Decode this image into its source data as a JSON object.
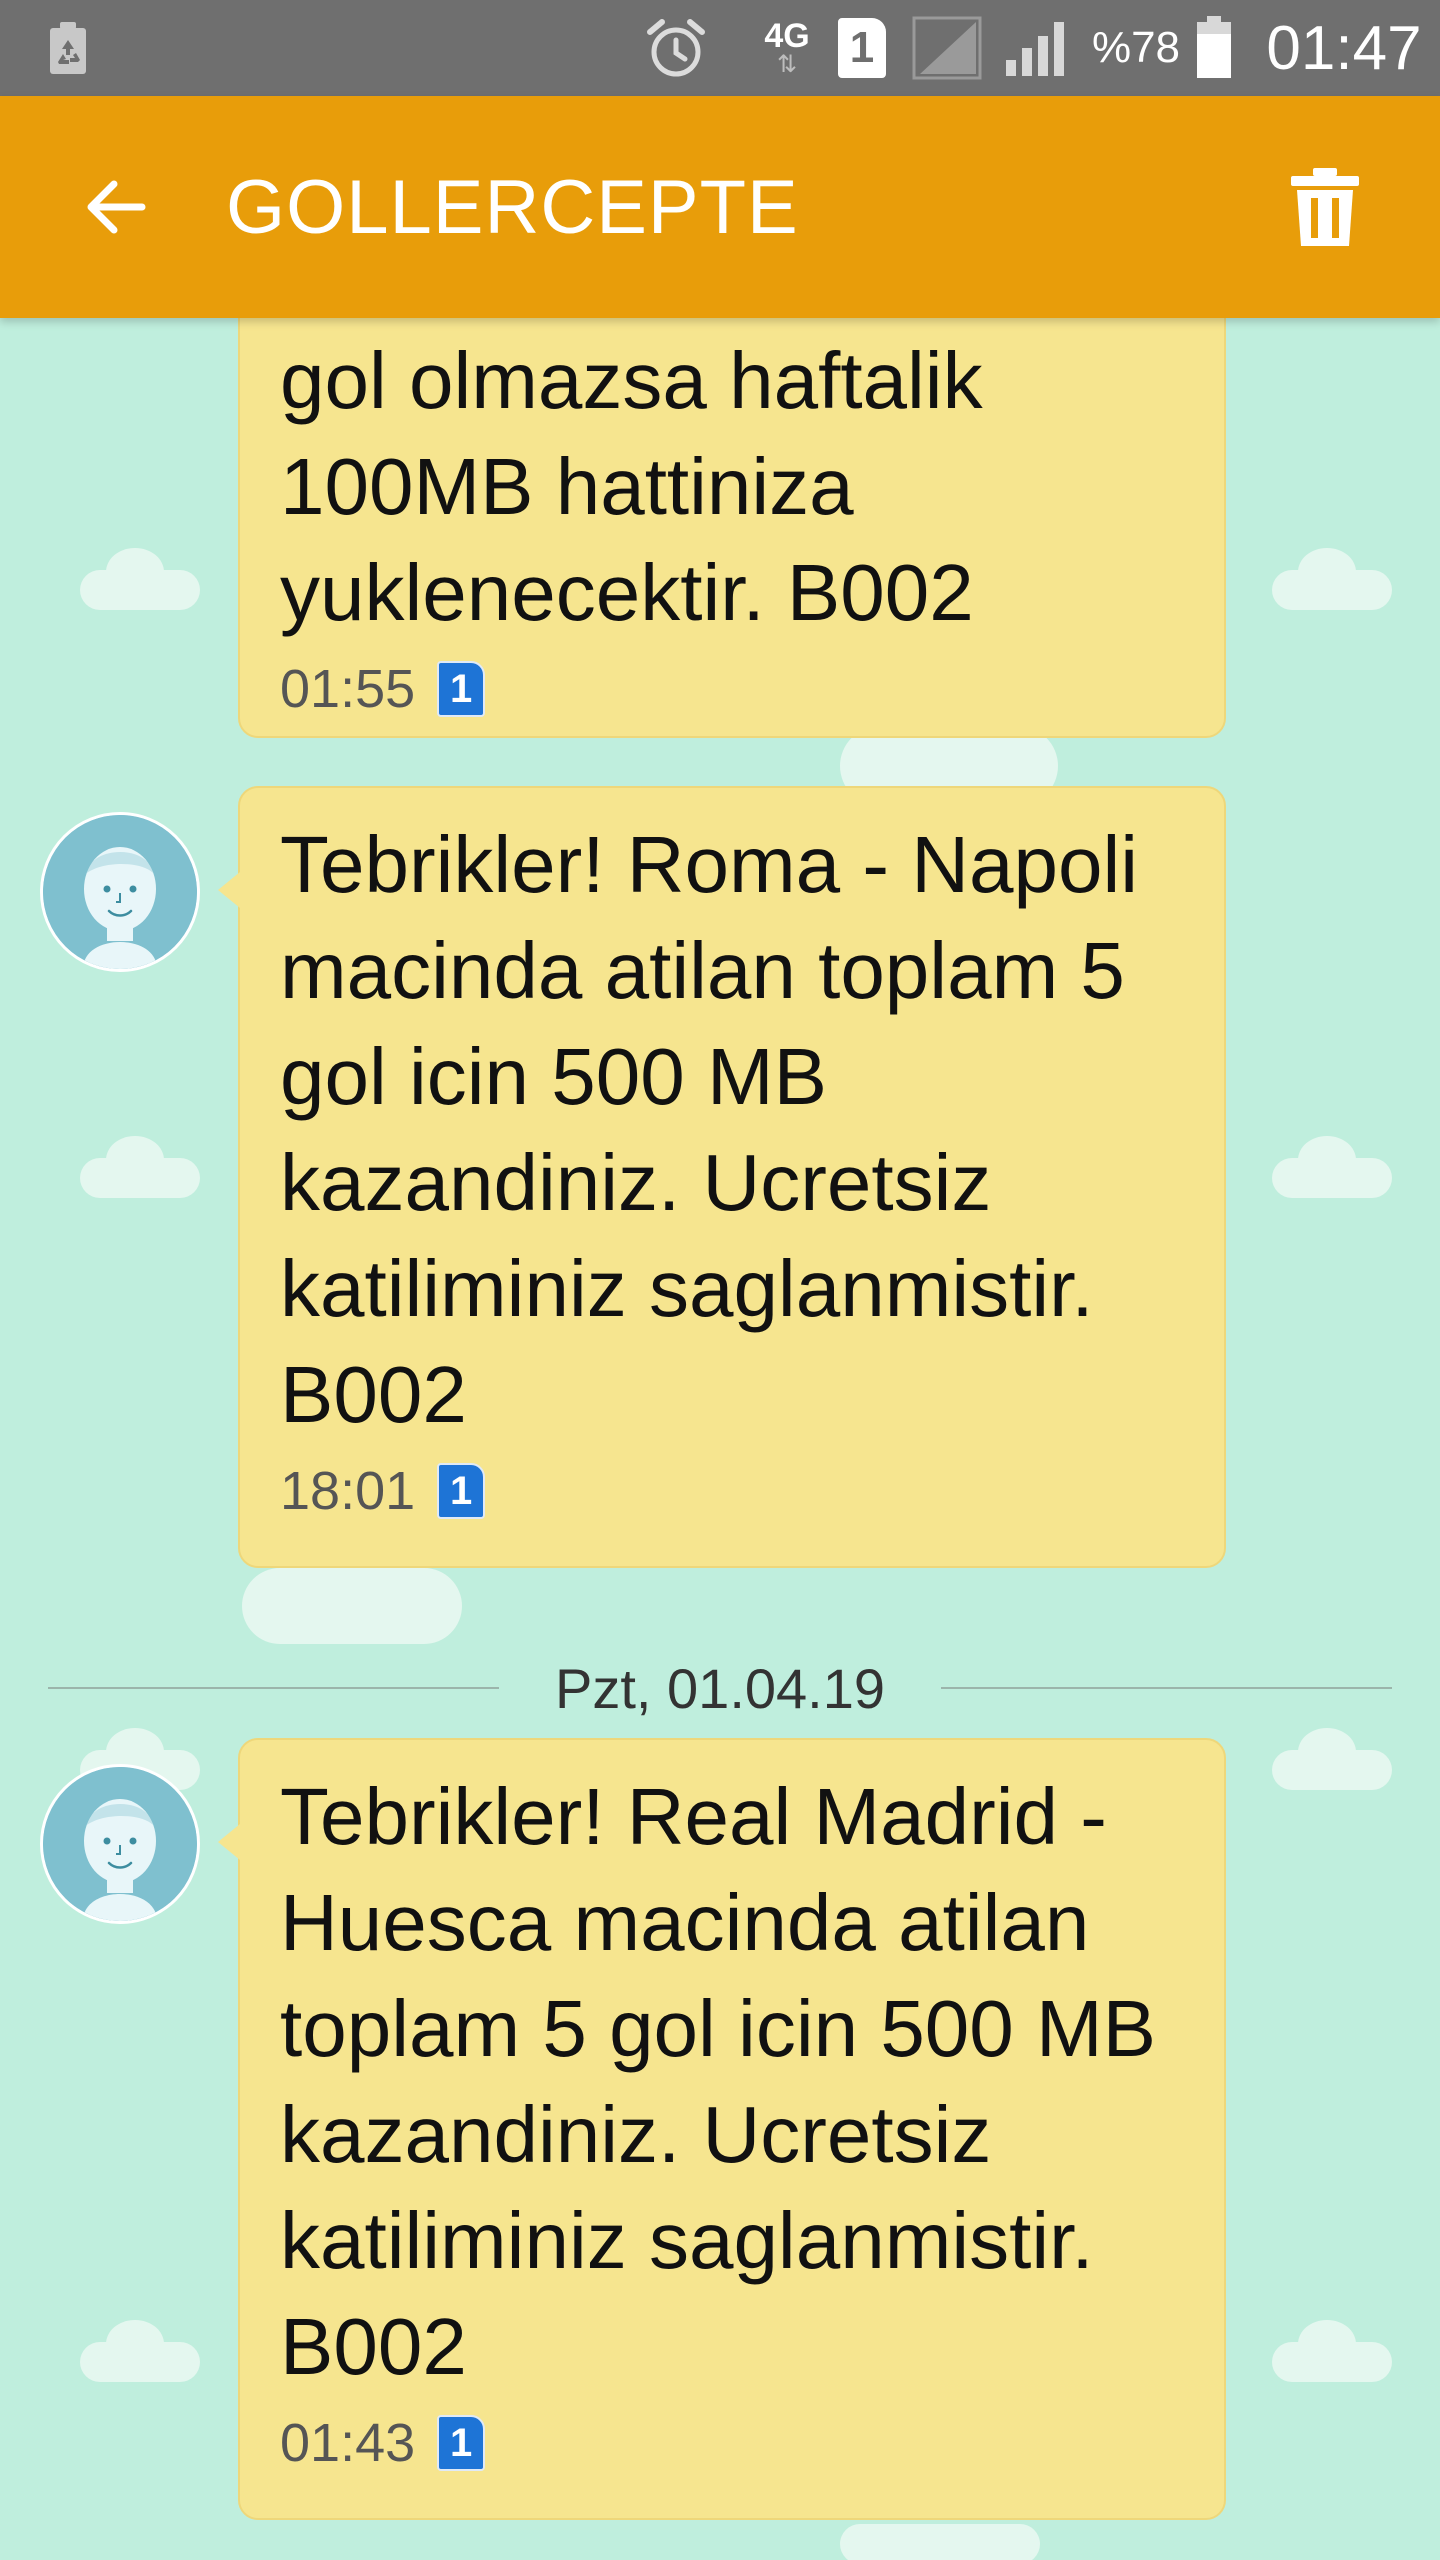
{
  "status_bar": {
    "network_type": "4G",
    "sim_slot": "1",
    "battery_percent": "%78",
    "time": "01:47",
    "icons": [
      "recycle-icon",
      "alarm-icon",
      "network-4g-icon",
      "sim-1-icon",
      "signal-icon",
      "signal-icon",
      "battery-icon"
    ]
  },
  "app_bar": {
    "title": "GOLLERCEPTE",
    "back_icon": "arrow-left-icon",
    "delete_icon": "trash-icon",
    "color": "#e89d0a"
  },
  "conversation": {
    "background_color": "#bfeedd",
    "bubble_color": "#f6e58f",
    "messages": [
      {
        "text": "gol olmazsa haftalik 100MB hattiniza yuklenecektir. B002",
        "time": "01:55",
        "sim": "1"
      },
      {
        "text": "Tebrikler! Roma - Napoli macinda atilan toplam 5 gol icin 500 MB kazandiniz. Ucretsiz katiliminiz saglanmistir. B002",
        "time": "18:01",
        "sim": "1"
      },
      {
        "text": "Tebrikler! Real Madrid - Huesca macinda atilan toplam 5 gol icin 500 MB kazandiniz. Ucretsiz katiliminiz saglanmistir. B002",
        "time": "01:43",
        "sim": "1"
      }
    ],
    "date_separator": "Pzt, 01.04.19"
  }
}
